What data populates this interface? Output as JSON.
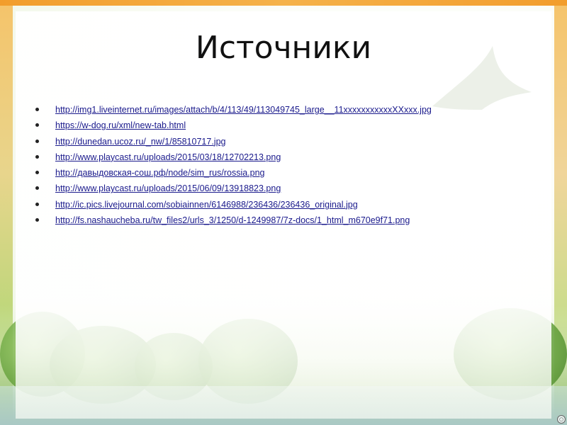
{
  "slide": {
    "title": "Источники",
    "sources": [
      "http://img1.liveinternet.ru/images/attach/b/4/113/49/113049745_large__11xxxxxxxxxxxXXxxx.jpg",
      "https://w-dog.ru/xml/new-tab.html",
      "http://dunedan.ucoz.ru/_nw/1/85810717.jpg",
      "http://www.playcast.ru/uploads/2015/03/18/12702213.png",
      "http://давыдовская-сош.рф/node/sim_rus/rossia.png",
      "http://www.playcast.ru/uploads/2015/06/09/13918823.png",
      "http://ic.pics.livejournal.com/sobiainnen/6146988/236436/236436_original.jpg",
      "http://fs.nashaucheba.ru/tw_files2/urls_3/1250/d-1249987/7z-docs/1_html_m670e9f71.png"
    ]
  },
  "colors": {
    "accent_bar": "#f29d2c",
    "link": "#1a1a8c",
    "title": "#111111"
  },
  "icons": {
    "background": "meadow-with-bird-illustration"
  }
}
